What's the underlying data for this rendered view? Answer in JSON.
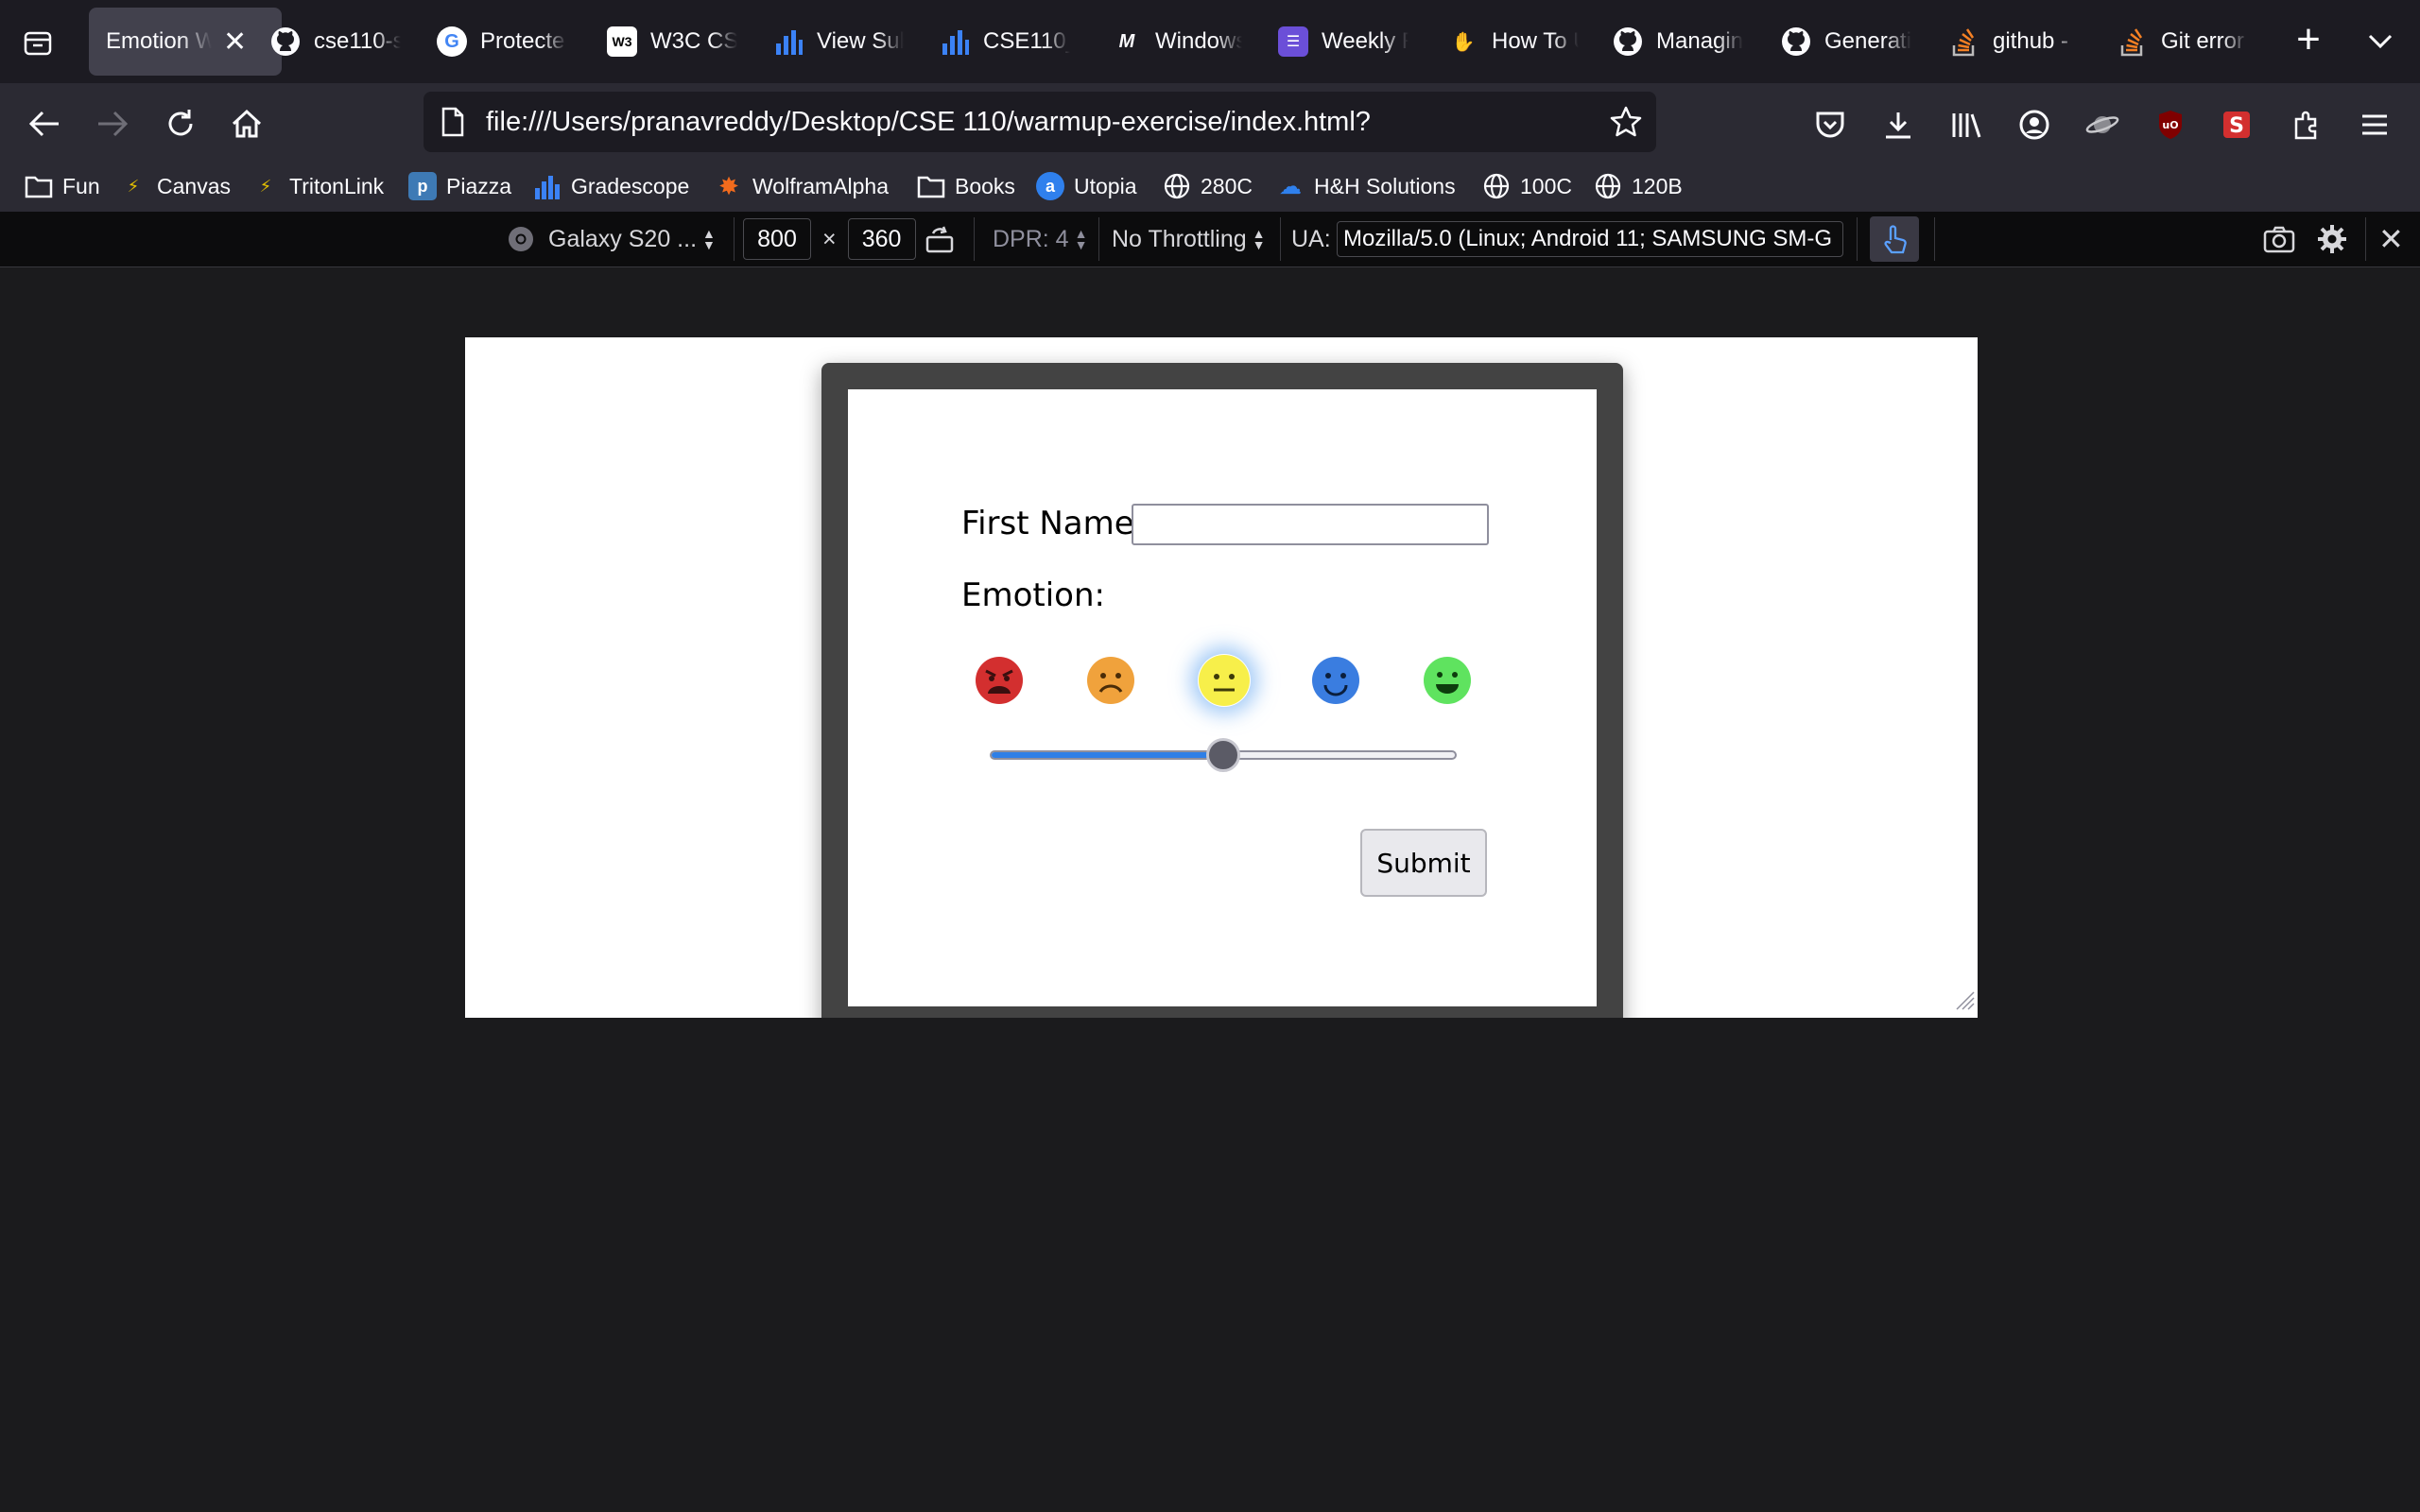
{
  "tabs": [
    {
      "label": "Emotion W",
      "favicon": "",
      "active": true
    },
    {
      "label": "cse110-s",
      "favicon": "github-icon"
    },
    {
      "label": "Protecte",
      "favicon": "google-icon"
    },
    {
      "label": "W3C CSS",
      "favicon": "w3c-icon"
    },
    {
      "label": "View Sub",
      "favicon": "bar-chart-icon"
    },
    {
      "label": "CSE110_",
      "favicon": "bar-chart-icon"
    },
    {
      "label": "Windows",
      "favicon": "m-icon"
    },
    {
      "label": "Weekly R",
      "favicon": "list-icon"
    },
    {
      "label": "How To U",
      "favicon": "hand-icon"
    },
    {
      "label": "Managin",
      "favicon": "github-icon"
    },
    {
      "label": "Generati",
      "favicon": "github-icon"
    },
    {
      "label": "github -",
      "favicon": "stackoverflow-icon"
    },
    {
      "label": "Git error",
      "favicon": "stackoverflow-icon"
    }
  ],
  "urlbar": {
    "url": "file:///Users/pranavreddy/Desktop/CSE 110/warmup-exercise/index.html?"
  },
  "bookmarks": [
    {
      "label": "Fun"
    },
    {
      "label": "Canvas"
    },
    {
      "label": "TritonLink"
    },
    {
      "label": "Piazza"
    },
    {
      "label": "Gradescope"
    },
    {
      "label": "WolframAlpha"
    },
    {
      "label": "Books"
    },
    {
      "label": "Utopia"
    },
    {
      "label": "280C"
    },
    {
      "label": "H&H Solutions"
    },
    {
      "label": "100C"
    },
    {
      "label": "120B"
    }
  ],
  "rdm": {
    "device": "Galaxy S20 ...",
    "width": "800",
    "times": "×",
    "height": "360",
    "dpr": "DPR: 4",
    "throttling": "No Throttling",
    "ua_label": "UA:",
    "ua_value": "Mozilla/5.0 (Linux; Android 11; SAMSUNG SM-G"
  },
  "page": {
    "first_name_label": "First Name:",
    "first_name_value": "",
    "emotion_label": "Emotion:",
    "submit_label": "Submit",
    "slider_value": 0.5,
    "selected_emotion": 2,
    "emotions": [
      {
        "name": "angry",
        "color": "#d32f2f"
      },
      {
        "name": "sad",
        "color": "#f0a23c"
      },
      {
        "name": "neutral",
        "color": "#f7ef4a"
      },
      {
        "name": "smiling",
        "color": "#3a7de0"
      },
      {
        "name": "happy",
        "color": "#5fe35f"
      }
    ]
  },
  "colors": {
    "accent": "#2f7fe6",
    "frame": "#434343",
    "chrome_dark": "#1c1b22",
    "chrome": "#2b2a33"
  }
}
